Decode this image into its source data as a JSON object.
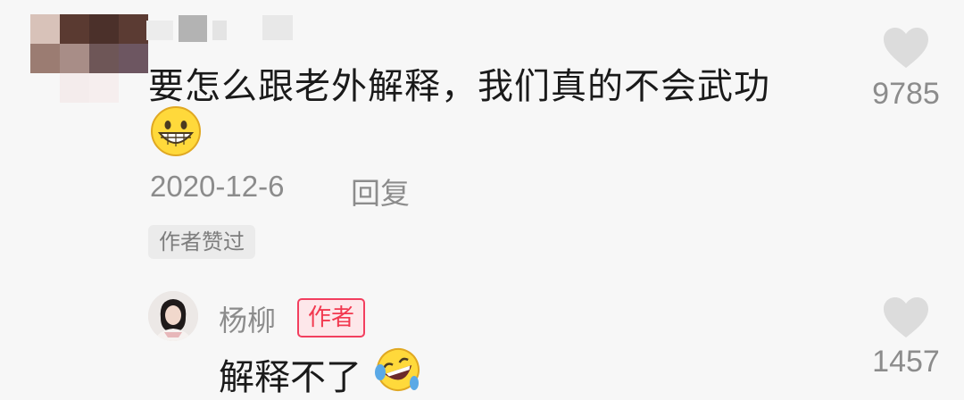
{
  "comment": {
    "text": "要怎么跟老外解释，我们真的不会武功",
    "date": "2020-12-6",
    "reply_label": "回复",
    "liked_badge": "作者赞过",
    "like_count": "9785",
    "emoji": "grinning-face"
  },
  "reply": {
    "username": "杨柳",
    "author_badge": "作者",
    "text": "解释不了",
    "like_count": "1457",
    "emoji": "rolling-on-floor-laughing"
  },
  "colors": {
    "background": "#f7f7f7",
    "text_primary": "#1a1a1a",
    "text_secondary": "#8c8c8c",
    "heart": "#dcdcdc",
    "author_badge_red": "#f23f5f"
  },
  "icons": {
    "like": "heart-icon"
  }
}
